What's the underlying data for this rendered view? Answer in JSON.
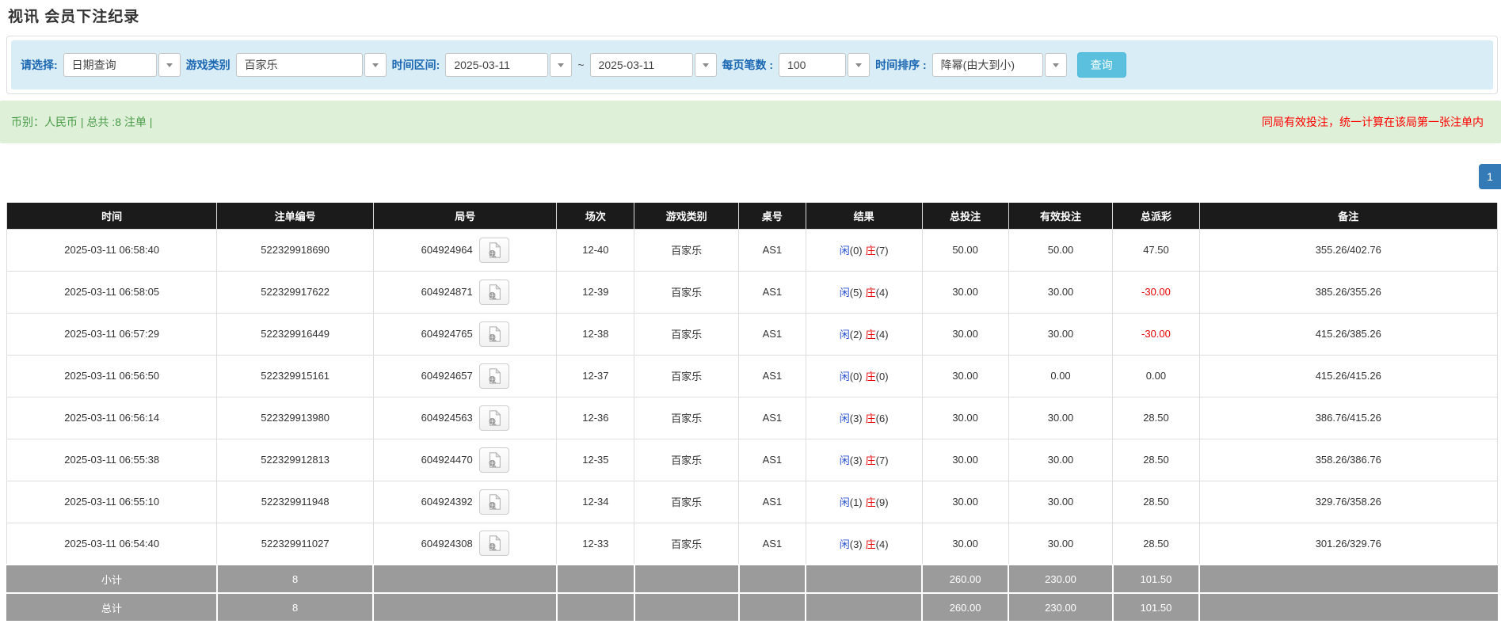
{
  "page": {
    "title": "视讯 会员下注纪录"
  },
  "filters": {
    "select_label": "请选择:",
    "select_value": "日期查询",
    "game_type_label": "游戏类别",
    "game_type_value": "百家乐",
    "time_range_label": "时间区间:",
    "date_from": "2025-03-11",
    "range_separator": "~",
    "date_to": "2025-03-11",
    "per_page_label": "每页笔数 :",
    "per_page_value": "100",
    "sort_label": "时间排序 :",
    "sort_value": "降幂(由大到小)",
    "search_button": "查询",
    "accent_color": "#d9edf7",
    "button_color": "#5bc0de"
  },
  "summary": {
    "left_text": "币别：人民币 | 总共 :8 注单 |",
    "right_text": "同局有效投注，统一计算在该局第一张注单内",
    "bar_color": "#dff0d8",
    "left_color": "#4a9c4a",
    "right_color": "#fe0000"
  },
  "pagination": {
    "current_page": "1",
    "active_color": "#337ab7"
  },
  "table": {
    "headers": [
      "时间",
      "注单编号",
      "局号",
      "场次",
      "游戏类别",
      "桌号",
      "结果",
      "总投注",
      "有效投注",
      "总派彩",
      "备注"
    ],
    "icons": {
      "round_video_icon": "film-file-icon"
    },
    "rows": [
      {
        "time": "2025-03-11 06:58:40",
        "bet_id": "522329918690",
        "round_no": "604924964",
        "session": "12-40",
        "game": "百家乐",
        "table_no": "AS1",
        "player_label": "闲",
        "player_score": "(0)",
        "banker_label": "庄",
        "banker_score": "(7)",
        "total_bet": "50.00",
        "valid_bet": "50.00",
        "payout": "47.50",
        "remark": "355.26/402.76"
      },
      {
        "time": "2025-03-11 06:58:05",
        "bet_id": "522329917622",
        "round_no": "604924871",
        "session": "12-39",
        "game": "百家乐",
        "table_no": "AS1",
        "player_label": "闲",
        "player_score": "(5)",
        "banker_label": "庄",
        "banker_score": "(4)",
        "total_bet": "30.00",
        "valid_bet": "30.00",
        "payout": "-30.00",
        "remark": "385.26/355.26"
      },
      {
        "time": "2025-03-11 06:57:29",
        "bet_id": "522329916449",
        "round_no": "604924765",
        "session": "12-38",
        "game": "百家乐",
        "table_no": "AS1",
        "player_label": "闲",
        "player_score": "(2)",
        "banker_label": "庄",
        "banker_score": "(4)",
        "total_bet": "30.00",
        "valid_bet": "30.00",
        "payout": "-30.00",
        "remark": "415.26/385.26"
      },
      {
        "time": "2025-03-11 06:56:50",
        "bet_id": "522329915161",
        "round_no": "604924657",
        "session": "12-37",
        "game": "百家乐",
        "table_no": "AS1",
        "player_label": "闲",
        "player_score": "(0)",
        "banker_label": "庄",
        "banker_score": "(0)",
        "total_bet": "30.00",
        "valid_bet": "0.00",
        "payout": "0.00",
        "remark": "415.26/415.26"
      },
      {
        "time": "2025-03-11 06:56:14",
        "bet_id": "522329913980",
        "round_no": "604924563",
        "session": "12-36",
        "game": "百家乐",
        "table_no": "AS1",
        "player_label": "闲",
        "player_score": "(3)",
        "banker_label": "庄",
        "banker_score": "(6)",
        "total_bet": "30.00",
        "valid_bet": "30.00",
        "payout": "28.50",
        "remark": "386.76/415.26"
      },
      {
        "time": "2025-03-11 06:55:38",
        "bet_id": "522329912813",
        "round_no": "604924470",
        "session": "12-35",
        "game": "百家乐",
        "table_no": "AS1",
        "player_label": "闲",
        "player_score": "(3)",
        "banker_label": "庄",
        "banker_score": "(7)",
        "total_bet": "30.00",
        "valid_bet": "30.00",
        "payout": "28.50",
        "remark": "358.26/386.76"
      },
      {
        "time": "2025-03-11 06:55:10",
        "bet_id": "522329911948",
        "round_no": "604924392",
        "session": "12-34",
        "game": "百家乐",
        "table_no": "AS1",
        "player_label": "闲",
        "player_score": "(1)",
        "banker_label": "庄",
        "banker_score": "(9)",
        "total_bet": "30.00",
        "valid_bet": "30.00",
        "payout": "28.50",
        "remark": "329.76/358.26"
      },
      {
        "time": "2025-03-11 06:54:40",
        "bet_id": "522329911027",
        "round_no": "604924308",
        "session": "12-33",
        "game": "百家乐",
        "table_no": "AS1",
        "player_label": "闲",
        "player_score": "(3)",
        "banker_label": "庄",
        "banker_score": "(4)",
        "total_bet": "30.00",
        "valid_bet": "30.00",
        "payout": "28.50",
        "remark": "301.26/329.76"
      }
    ],
    "subtotal": {
      "label": "小计",
      "count": "8",
      "total_bet": "260.00",
      "valid_bet": "230.00",
      "payout": "101.50"
    },
    "total": {
      "label": "总计",
      "count": "8",
      "total_bet": "260.00",
      "valid_bet": "230.00",
      "payout": "101.50"
    }
  }
}
